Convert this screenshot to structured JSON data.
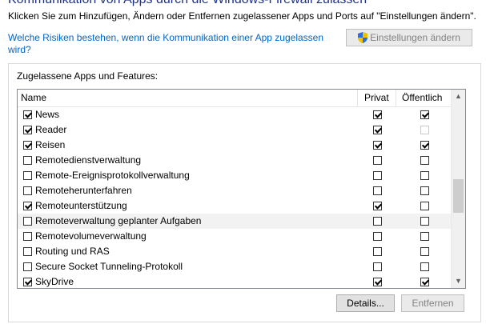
{
  "title": "Kommunikation von Apps durch die Windows-Firewall zulassen",
  "subtitle": "Klicken Sie zum Hinzufügen, Ändern oder Entfernen zugelassener Apps und Ports auf \"Einstellungen ändern\".",
  "risk_link": "Welche Risiken bestehen, wenn die Kommunikation einer App zugelassen wird?",
  "settings_button": "Einstellungen ändern",
  "group_label": "Zugelassene Apps und Features:",
  "columns": {
    "name": "Name",
    "private": "Privat",
    "public": "Öffentlich"
  },
  "apps": [
    {
      "name": "News",
      "enabled": true,
      "private": true,
      "public": true
    },
    {
      "name": "Reader",
      "enabled": true,
      "private": true,
      "public": false,
      "public_disabled": true
    },
    {
      "name": "Reisen",
      "enabled": true,
      "private": true,
      "public": true
    },
    {
      "name": "Remotedienstverwaltung",
      "enabled": false,
      "private": false,
      "public": false
    },
    {
      "name": "Remote-Ereignisprotokollverwaltung",
      "enabled": false,
      "private": false,
      "public": false
    },
    {
      "name": "Remoteherunterfahren",
      "enabled": false,
      "private": false,
      "public": false
    },
    {
      "name": "Remoteunterstützung",
      "enabled": true,
      "private": true,
      "public": false
    },
    {
      "name": "Remoteverwaltung geplanter Aufgaben",
      "enabled": false,
      "private": false,
      "public": false,
      "highlighted": true
    },
    {
      "name": "Remotevolumeverwaltung",
      "enabled": false,
      "private": false,
      "public": false
    },
    {
      "name": "Routing und RAS",
      "enabled": false,
      "private": false,
      "public": false
    },
    {
      "name": "Secure Socket Tunneling-Protokoll",
      "enabled": false,
      "private": false,
      "public": false
    },
    {
      "name": "SkyDrive",
      "enabled": true,
      "private": true,
      "public": true
    }
  ],
  "scroll_position": 0.55,
  "details_button": "Details...",
  "remove_button": "Entfernen",
  "colors": {
    "title": "#1e3287",
    "link": "#0066cc",
    "shield_blue": "#2a6fd6",
    "shield_yellow": "#f2c200"
  }
}
